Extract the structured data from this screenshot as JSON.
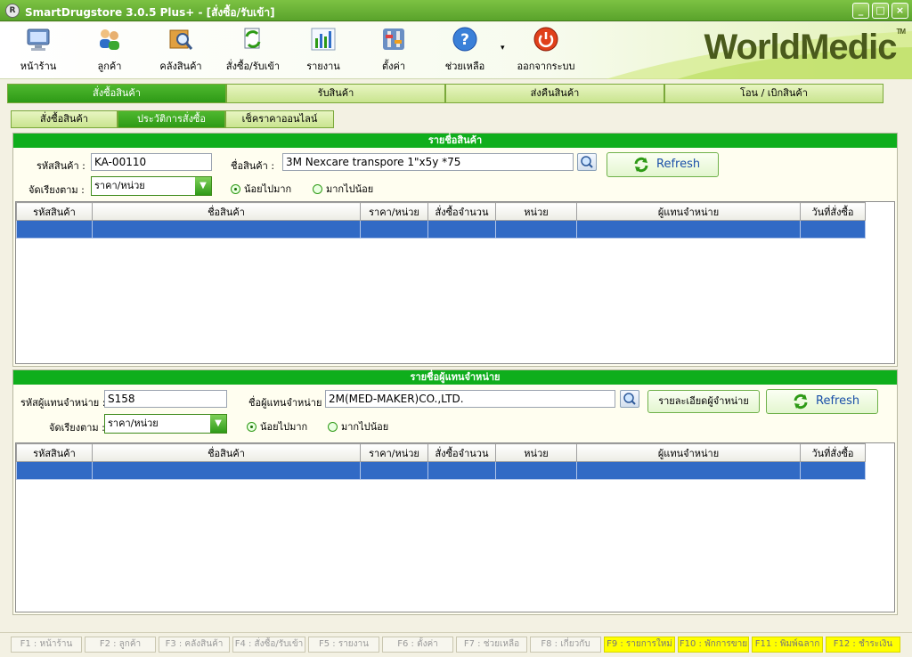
{
  "window": {
    "title": "SmartDrugstore 3.0.5 Plus+ - [สั่งซื้อ/รับเข้า]",
    "logo_letter": "R",
    "minimize": "_",
    "maximize": "□",
    "close": "×"
  },
  "toolbar": {
    "items": [
      {
        "label": "หน้าร้าน",
        "icon": "monitor-icon"
      },
      {
        "label": "ลูกค้า",
        "icon": "customers-icon"
      },
      {
        "label": "คลังสินค้า",
        "icon": "warehouse-search-icon"
      },
      {
        "label": "สั่งซื้อ/รับเข้า",
        "icon": "order-receive-icon"
      },
      {
        "label": "รายงาน",
        "icon": "report-chart-icon"
      },
      {
        "label": "ตั้งค่า",
        "icon": "settings-icon"
      },
      {
        "label": "ช่วยเหลือ",
        "icon": "help-icon"
      },
      {
        "label": "ออกจากระบบ",
        "icon": "power-icon"
      }
    ],
    "help_dropdown": "▾",
    "brand": "WorldMedic",
    "brand_tm": "TM"
  },
  "main_tabs": [
    "สั่งซื้อสินค้า",
    "รับสินค้า",
    "ส่งคืนสินค้า",
    "โอน / เบิกสินค้า"
  ],
  "sub_tabs": [
    "สั่งซื้อสินค้า",
    "ประวัติการสั่งซื้อ",
    "เช็คราคาออนไลน์"
  ],
  "product_panel": {
    "header": "รายชื่อสินค้า",
    "code_label": "รหัสสินค้า :",
    "code_value": "KA-00110",
    "name_label": "ชื่อสินค้า :",
    "name_value": "3M Nexcare transpore 1\"x5y *75",
    "sort_label": "จัดเรียงตาม :",
    "sort_value": "ราคา/หน่วย",
    "radio_asc": "น้อยไปมาก",
    "radio_desc": "มากไปน้อย",
    "refresh": "Refresh",
    "columns": [
      "รหัสสินค้า",
      "ชื่อสินค้า",
      "ราคา/หน่วย",
      "สั่งซื้อจำนวน",
      "หน่วย",
      "ผู้แทนจำหน่าย",
      "วันที่สั่งซื้อ"
    ]
  },
  "supplier_panel": {
    "header": "รายชื่อผู้แทนจำหน่าย",
    "code_label": "รหัสผู้แทนจำหน่าย :",
    "code_value": "S158",
    "name_label": "ชื่อผู้แทนจำหน่าย :",
    "name_value": "2M(MED-MAKER)CO.,LTD.",
    "detail_button": "รายละเอียดผู้จำหน่าย",
    "sort_label": "จัดเรียงตาม :",
    "sort_value": "ราคา/หน่วย",
    "radio_asc": "น้อยไปมาก",
    "radio_desc": "มากไปน้อย",
    "refresh": "Refresh",
    "columns": [
      "รหัสสินค้า",
      "ชื่อสินค้า",
      "ราคา/หน่วย",
      "สั่งซื้อจำนวน",
      "หน่วย",
      "ผู้แทนจำหน่าย",
      "วันที่สั่งซื้อ"
    ]
  },
  "status_keys": [
    {
      "label": "F1 : หน้าร้าน",
      "highlight": false
    },
    {
      "label": "F2 : ลูกค้า",
      "highlight": false
    },
    {
      "label": "F3 : คลังสินค้า",
      "highlight": false
    },
    {
      "label": "F4 : สั่งซื้อ/รับเข้า",
      "highlight": false
    },
    {
      "label": "F5 : รายงาน",
      "highlight": false
    },
    {
      "label": "F6 : ตั้งค่า",
      "highlight": false
    },
    {
      "label": "F7 : ช่วยเหลือ",
      "highlight": false
    },
    {
      "label": "F8 : เกี่ยวกับ",
      "highlight": false
    },
    {
      "label": "F9 : รายการใหม่",
      "highlight": true
    },
    {
      "label": "F10 : พักการขาย",
      "highlight": true
    },
    {
      "label": "F11 : พิมพ์ฉลาก",
      "highlight": true
    },
    {
      "label": "F12 : ชำระเงิน",
      "highlight": true
    }
  ],
  "colors": {
    "accent_green": "#0fae1c",
    "selection_blue": "#316ac5",
    "highlight_yellow": "#ffff00"
  }
}
